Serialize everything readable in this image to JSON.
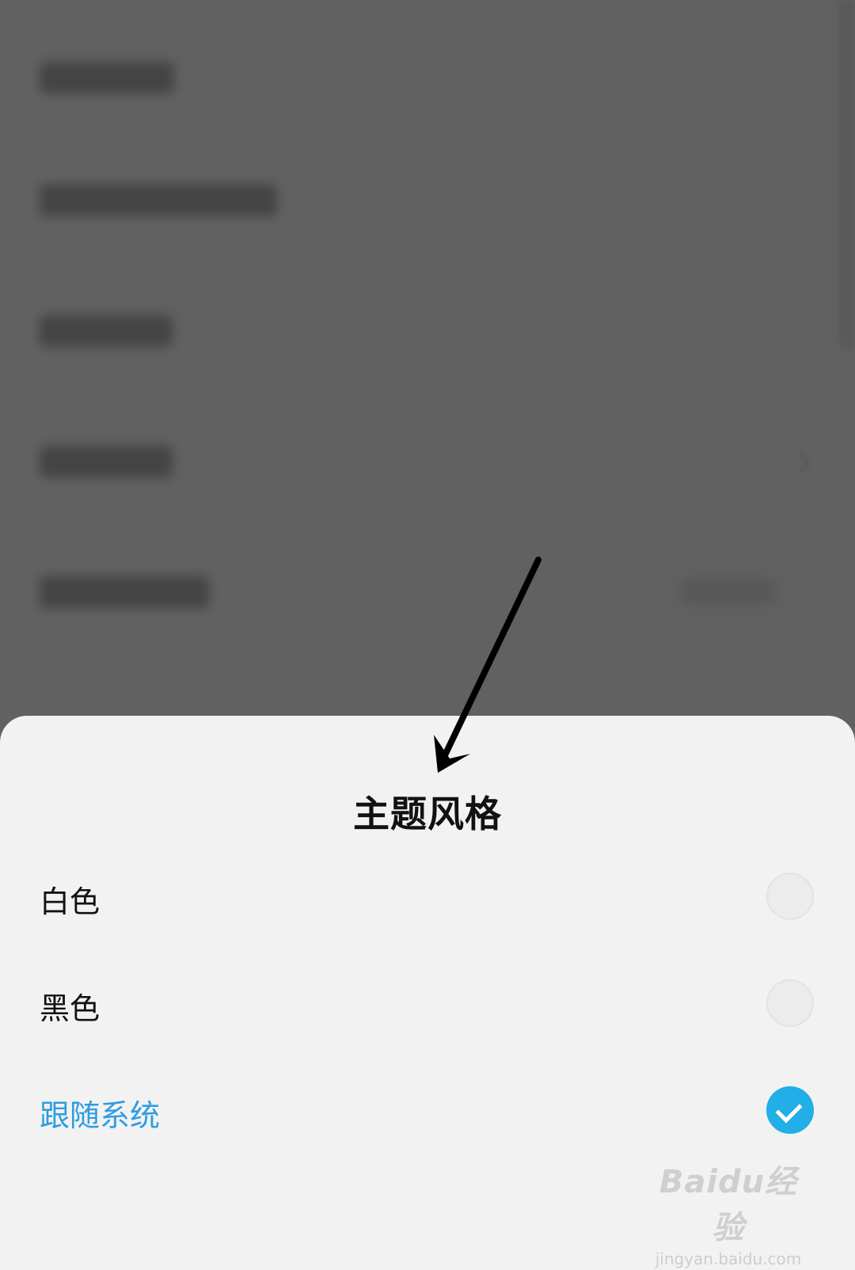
{
  "sheet": {
    "title": "主题风格",
    "options": [
      {
        "label": "白色",
        "selected": false
      },
      {
        "label": "黑色",
        "selected": false
      },
      {
        "label": "跟随系统",
        "selected": true
      }
    ]
  },
  "watermark": {
    "logo": "Baidu经验",
    "url": "jingyan.baidu.com"
  },
  "colors": {
    "accent": "#22aee6",
    "selected_text": "#2c9ee0",
    "overlay": "#616161",
    "sheet_bg": "#f2f2f2"
  },
  "icons": {
    "check": "checkmark-icon",
    "annotation": "arrow-icon"
  }
}
